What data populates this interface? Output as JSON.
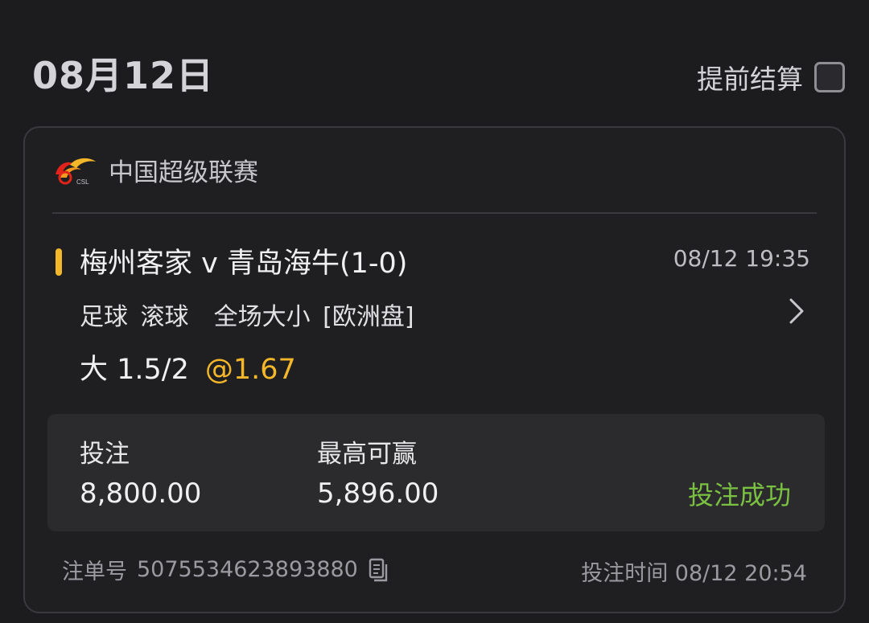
{
  "header": {
    "date": "08月12日",
    "early_settle_label": "提前结算"
  },
  "card": {
    "league_name": "中国超级联赛",
    "match_title": "梅州客家 v 青岛海牛(1-0)",
    "match_time": "08/12 19:35",
    "bet_type": "足球 滚球  全场大小 [欧洲盘]",
    "selection": "大 1.5/2",
    "odds": "@1.67",
    "stake_label": "投注",
    "stake_value": "8,800.00",
    "max_win_label": "最高可赢",
    "max_win_value": "5,896.00",
    "status": "投注成功",
    "order_no_label": "注单号",
    "order_no": "5075534623893880",
    "bet_time": "投注时间 08/12 20:54"
  },
  "icons": {
    "league_logo": "csl-logo-icon",
    "chevron": "chevron-right-icon",
    "copy": "copy-icon",
    "checkbox": "checkbox-unchecked-icon"
  },
  "colors": {
    "background": "#1c1c1f",
    "accent": "#f5b72a",
    "success": "#7ac142"
  }
}
